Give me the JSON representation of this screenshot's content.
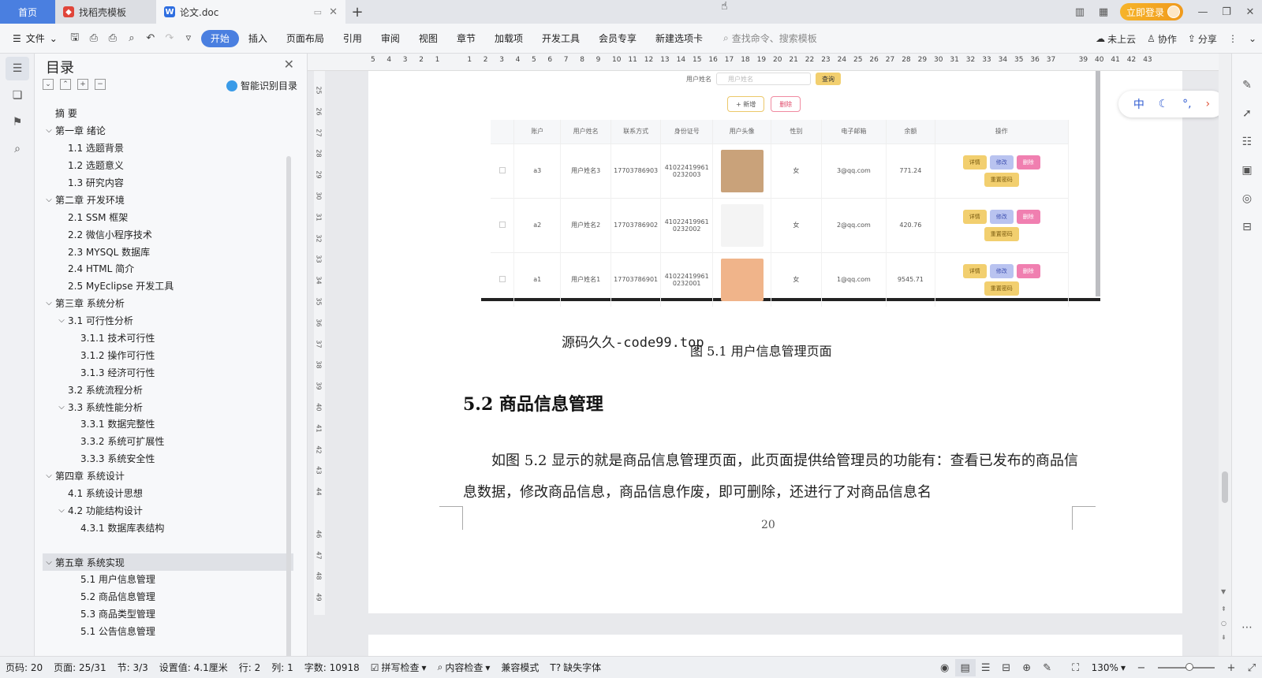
{
  "titlebar": {
    "home_tab": "首页",
    "tabs": [
      {
        "label": "找稻壳模板",
        "icon": "docer-icon",
        "active": false
      },
      {
        "label": "论文.doc",
        "icon": "word-doc-icon",
        "active": true
      }
    ],
    "login_label": "立即登录"
  },
  "menubar": {
    "file_label": "文件",
    "items": [
      "开始",
      "插入",
      "页面布局",
      "引用",
      "审阅",
      "视图",
      "章节",
      "加载项",
      "开发工具",
      "会员专享",
      "新建选项卡"
    ],
    "search_placeholder": "查找命令、搜索模板",
    "right": {
      "cloud": "未上云",
      "collab": "协作",
      "share": "分享"
    }
  },
  "toc": {
    "title": "目录",
    "smart_label": "智能识别目录",
    "items": [
      {
        "level": 0,
        "label": "摘  要",
        "arrow": ""
      },
      {
        "level": 0,
        "label": "第一章 绪论",
        "arrow": "v"
      },
      {
        "level": 1,
        "label": "1.1 选题背景",
        "arrow": ""
      },
      {
        "level": 1,
        "label": "1.2 选题意义",
        "arrow": ""
      },
      {
        "level": 1,
        "label": "1.3 研究内容",
        "arrow": ""
      },
      {
        "level": 0,
        "label": "第二章 开发环境",
        "arrow": "v"
      },
      {
        "level": 1,
        "label": "2.1 SSM 框架",
        "arrow": ""
      },
      {
        "level": 1,
        "label": "2.2 微信小程序技术",
        "arrow": ""
      },
      {
        "level": 1,
        "label": "2.3 MYSQL 数据库",
        "arrow": ""
      },
      {
        "level": 1,
        "label": "2.4 HTML 简介",
        "arrow": ""
      },
      {
        "level": 1,
        "label": "2.5 MyEclipse 开发工具",
        "arrow": ""
      },
      {
        "level": 0,
        "label": "第三章 系统分析",
        "arrow": "v"
      },
      {
        "level": 1,
        "label": "3.1 可行性分析",
        "arrow": "v"
      },
      {
        "level": 2,
        "label": "3.1.1 技术可行性",
        "arrow": ""
      },
      {
        "level": 2,
        "label": "3.1.2 操作可行性",
        "arrow": ""
      },
      {
        "level": 2,
        "label": "3.1.3 经济可行性",
        "arrow": ""
      },
      {
        "level": 1,
        "label": "3.2 系统流程分析",
        "arrow": ""
      },
      {
        "level": 1,
        "label": "3.3 系统性能分析",
        "arrow": "v"
      },
      {
        "level": 2,
        "label": "3.3.1 数据完整性",
        "arrow": ""
      },
      {
        "level": 2,
        "label": "3.3.2 系统可扩展性",
        "arrow": ""
      },
      {
        "level": 2,
        "label": "3.3.3 系统安全性",
        "arrow": ""
      },
      {
        "level": 0,
        "label": "第四章 系统设计",
        "arrow": "v"
      },
      {
        "level": 1,
        "label": "4.1 系统设计思想",
        "arrow": ""
      },
      {
        "level": 1,
        "label": "4.2 功能结构设计",
        "arrow": "v"
      },
      {
        "level": 2,
        "label": "4.3.1 数据库表结构",
        "arrow": ""
      },
      {
        "level": 0,
        "label": "",
        "arrow": ""
      },
      {
        "level": 0,
        "label": "第五章 系统实现",
        "arrow": "v",
        "selected": true
      },
      {
        "level": 2,
        "label": "5.1 用户信息管理",
        "arrow": ""
      },
      {
        "level": 2,
        "label": "5.2  商品信息管理",
        "arrow": ""
      },
      {
        "level": 2,
        "label": "5.3 商品类型管理",
        "arrow": ""
      },
      {
        "level": 2,
        "label": "5.1 公告信息管理",
        "arrow": ""
      }
    ]
  },
  "ruler": {
    "top_ticks": [
      "5",
      "4",
      "3",
      "2",
      "1",
      "",
      "1",
      "2",
      "3",
      "4",
      "5",
      "6",
      "7",
      "8",
      "9",
      "10",
      "11",
      "12",
      "13",
      "14",
      "15",
      "16",
      "17",
      "18",
      "19",
      "20",
      "21",
      "22",
      "23",
      "24",
      "25",
      "26",
      "27",
      "28",
      "29",
      "30",
      "31",
      "32",
      "33",
      "34",
      "35",
      "36",
      "37",
      "",
      "39",
      "40",
      "41",
      "42",
      "43"
    ],
    "left_ticks": [
      "25",
      "26",
      "27",
      "28",
      "29",
      "30",
      "31",
      "32",
      "33",
      "34",
      "35",
      "36",
      "37",
      "38",
      "39",
      "40",
      "41",
      "42",
      "43",
      "44",
      "",
      "46",
      "47",
      "48",
      "49"
    ]
  },
  "screenshot_embed": {
    "search_label": "用户姓名",
    "search_placeholder": "用户姓名",
    "search_btn": "查询",
    "add_btn": "+ 新增",
    "del_btn": "删除",
    "headers": [
      "",
      "账户",
      "用户姓名",
      "联系方式",
      "身份证号",
      "用户头像",
      "性别",
      "电子邮箱",
      "余额",
      "操作"
    ],
    "rows": [
      {
        "account": "a3",
        "name": "用户姓名3",
        "phone": "17703786903",
        "id1": "41022419961",
        "id2": "0232003",
        "gender": "女",
        "email": "3@qq.com",
        "balance": "771.24",
        "avatar_color": "#c9a27a"
      },
      {
        "account": "a2",
        "name": "用户姓名2",
        "phone": "17703786902",
        "id1": "41022419961",
        "id2": "0232002",
        "gender": "女",
        "email": "2@qq.com",
        "balance": "420.76",
        "avatar_color": "#f4f4f4"
      },
      {
        "account": "a1",
        "name": "用户姓名1",
        "phone": "17703786901",
        "id1": "41022419961",
        "id2": "0232001",
        "gender": "女",
        "email": "1@qq.com",
        "balance": "9545.71",
        "avatar_color": "#f0b48a"
      }
    ],
    "ops": {
      "detail": "详情",
      "edit": "修改",
      "delete": "删除",
      "reset": "重置密码"
    }
  },
  "document": {
    "watermark": "源码久久-code99.top",
    "caption": "图 5.1  用户信息管理页面",
    "heading": "5.2  商品信息管理",
    "paragraph": "如图 5.2 显示的就是商品信息管理页面，此页面提供给管理员的功能有：查看已发布的商品信息数据，修改商品信息，商品信息作废，即可删除，还进行了对商品信息名",
    "page_number": "20"
  },
  "ime": {
    "lang": "中"
  },
  "statusbar": {
    "page": "页码: 20",
    "pages": "页面: 25/31",
    "section": "节: 3/3",
    "setting": "设置值: 4.1厘米",
    "row": "行: 2",
    "col": "列: 1",
    "words": "字数: 10918",
    "spell": "拼写检查",
    "content": "内容检查",
    "compat": "兼容模式",
    "missing_font": "缺失字体",
    "zoom": "130%",
    "zoom_level": 0.55
  },
  "colors": {
    "accent": "#4a7fe0",
    "login": "#f4a623"
  }
}
